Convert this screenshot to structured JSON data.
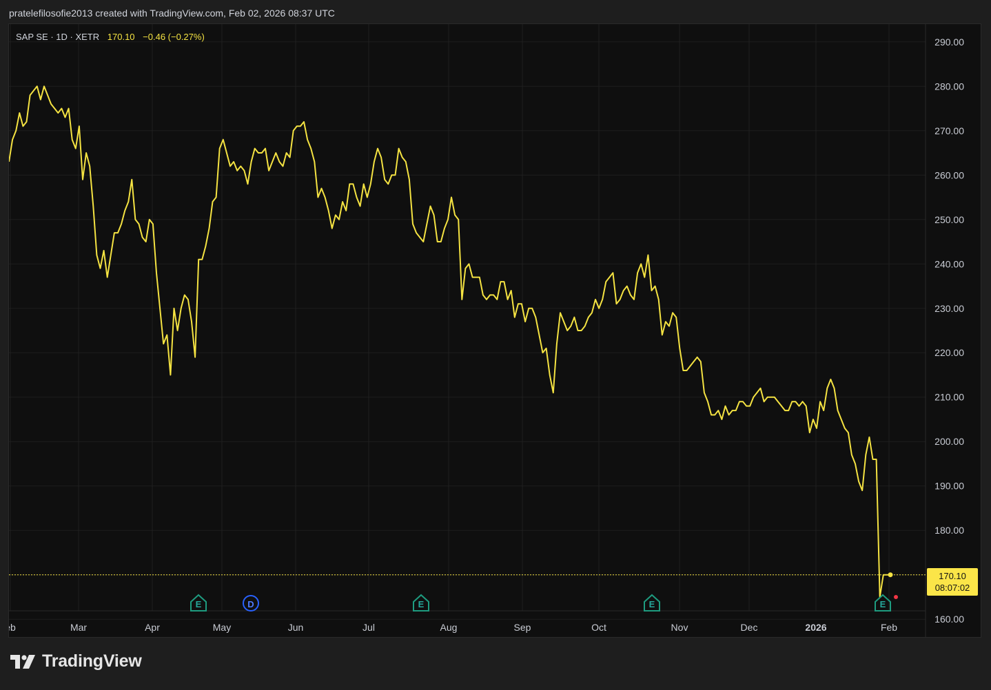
{
  "header": {
    "credit": "pratelefilosofie2013 created with TradingView.com, Feb 02, 2026 08:37 UTC"
  },
  "legend": {
    "symbol": "SAP SE · 1D · XETR",
    "price": "170.10",
    "change": "−0.46 (−0.27%)"
  },
  "price_tag": {
    "price": "170.10",
    "countdown": "08:07:02"
  },
  "event_markers": [
    {
      "label": "E",
      "icon": "earnings-icon",
      "color": "#1e9c80"
    },
    {
      "label": "D",
      "icon": "dividend-icon",
      "color": "#2962ff"
    },
    {
      "label": "E",
      "icon": "earnings-icon",
      "color": "#1e9c80"
    },
    {
      "label": "E",
      "icon": "earnings-icon",
      "color": "#1e9c80"
    },
    {
      "label": "E",
      "icon": "earnings-icon",
      "color": "#1e9c80"
    }
  ],
  "brand": {
    "name": "TradingView",
    "icon": "tradingview-logo-icon"
  },
  "colors": {
    "line": "#f5e342",
    "background": "#0f0f0f",
    "grid": "#1f1f1f",
    "tag": "#fbe548"
  },
  "chart_data": {
    "type": "line",
    "title": "SAP SE · 1D · XETR",
    "ylim": [
      156,
      294
    ],
    "y_ticks": [
      "290.00",
      "280.00",
      "270.00",
      "260.00",
      "250.00",
      "240.00",
      "230.00",
      "220.00",
      "210.00",
      "200.00",
      "190.00",
      "180.00",
      "170.00",
      "160.00"
    ],
    "x_tick_labels": [
      "eb",
      "Mar",
      "Apr",
      "May",
      "Jun",
      "Jul",
      "Aug",
      "Sep",
      "Oct",
      "Nov",
      "Dec",
      "2026",
      "Feb"
    ],
    "grid": true,
    "legend": "top-left",
    "series": [
      {
        "values": [
          263,
          268,
          270,
          274,
          271,
          272,
          278,
          279,
          280,
          277,
          280,
          278,
          276,
          275,
          274,
          275,
          273,
          275,
          268,
          266,
          271,
          259,
          265,
          262,
          253,
          242,
          239,
          243,
          237,
          242,
          247,
          247,
          249,
          252,
          254,
          259,
          250,
          249,
          246,
          245,
          250,
          249,
          238,
          230,
          222,
          224,
          215,
          230,
          225,
          230,
          233,
          232,
          227,
          219,
          241,
          241,
          244,
          248,
          254,
          255,
          266,
          268,
          265,
          262,
          263,
          261,
          262,
          261,
          258,
          263,
          266,
          265,
          265,
          266,
          261,
          263,
          265,
          263,
          262,
          265,
          264,
          270,
          271,
          271,
          272,
          268,
          266,
          263,
          255,
          257,
          255,
          252,
          248,
          251,
          250,
          254,
          252,
          258,
          258,
          255,
          253,
          258,
          255,
          258,
          263,
          266,
          264,
          259,
          258,
          260,
          260,
          266,
          264,
          263,
          259,
          249,
          247,
          246,
          245,
          249,
          253,
          251,
          245,
          245,
          248,
          250,
          255,
          251,
          250,
          232,
          239,
          240,
          237,
          237,
          237,
          233,
          232,
          233,
          233,
          232,
          236,
          236,
          232,
          234,
          228,
          231,
          231,
          227,
          230,
          230,
          228,
          224,
          220,
          221,
          215,
          211,
          222,
          229,
          227,
          225,
          226,
          228,
          225,
          225,
          226,
          228,
          229,
          232,
          230,
          232,
          236,
          237,
          238,
          231,
          232,
          234,
          235,
          233,
          232,
          238,
          240,
          237,
          242,
          234,
          235,
          232,
          224,
          227,
          226,
          229,
          228,
          221,
          216,
          216,
          217,
          218,
          219,
          218,
          211,
          209,
          206,
          206,
          207,
          205,
          208,
          206,
          207,
          207,
          209,
          209,
          208,
          208,
          210,
          211,
          212,
          209,
          210,
          210,
          210,
          209,
          208,
          207,
          207,
          209,
          209,
          208,
          209,
          208,
          202,
          205,
          203,
          209,
          207,
          212,
          214,
          212,
          207,
          205,
          203,
          202,
          197,
          195,
          191,
          189,
          197,
          201,
          196,
          196,
          165,
          170,
          170,
          170
        ]
      }
    ]
  }
}
